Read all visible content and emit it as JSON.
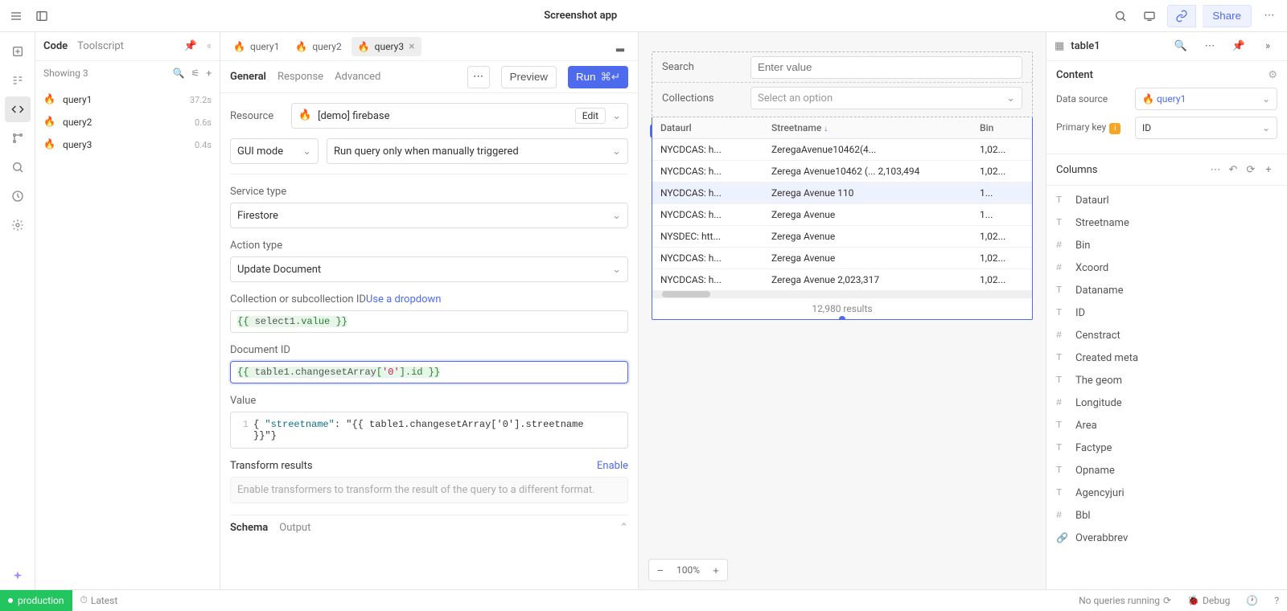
{
  "app_title": "Screenshot app",
  "topbar": {
    "share_label": "Share"
  },
  "code_panel": {
    "tabs": {
      "code": "Code",
      "toolscript": "Toolscript"
    },
    "showing": "Showing 3",
    "queries": [
      {
        "name": "query1",
        "time": "37.2s"
      },
      {
        "name": "query2",
        "time": "0.6s"
      },
      {
        "name": "query3",
        "time": "0.4s"
      }
    ]
  },
  "editor": {
    "tabs": [
      {
        "name": "query1",
        "active": false
      },
      {
        "name": "query2",
        "active": false
      },
      {
        "name": "query3",
        "active": true
      }
    ],
    "subtabs": {
      "general": "General",
      "response": "Response",
      "advanced": "Advanced"
    },
    "preview": "Preview",
    "run": "Run",
    "run_shortcut": "⌘↵",
    "resource_label": "Resource",
    "resource_name": "[demo] firebase",
    "edit": "Edit",
    "gui_mode": "GUI mode",
    "run_mode": "Run query only when manually triggered",
    "service_type_label": "Service type",
    "service_type": "Firestore",
    "action_type_label": "Action type",
    "action_type": "Update Document",
    "collection_label": "Collection or subcollection ID",
    "use_dropdown": "Use a dropdown",
    "collection_code_prefix": "{{ ",
    "collection_code_1": "select1",
    "collection_code_dot": ".",
    "collection_code_2": "value",
    "collection_code_suffix": " }}",
    "document_id_label": "Document ID",
    "doc_code_prefix": "{{ ",
    "doc_code_1": "table1",
    "doc_code_2": "changesetArray",
    "doc_code_idx": "'0'",
    "doc_code_3": "id",
    "doc_code_suffix": " }}",
    "value_label": "Value",
    "value_line_no": "1",
    "value_code_open": "{ ",
    "value_code_key": "\"streetname\"",
    "value_code_colon": ": ",
    "value_code_q1": "\"",
    "value_code_tmpl_open": "{{ ",
    "value_code_t1": "table1",
    "value_code_t2": "changesetArray",
    "value_code_idx": "'0'",
    "value_code_t3": "streetname",
    "value_code_tmpl_close": " }}",
    "value_code_q2": "\"",
    "value_code_close": "}",
    "transform_label": "Transform results",
    "enable": "Enable",
    "transform_placeholder": "Enable transformers to transform the result of the query to a different format.",
    "schema": "Schema",
    "output": "Output"
  },
  "canvas": {
    "table_chip": "table1",
    "search_label": "Search",
    "search_placeholder": "Enter value",
    "collections_label": "Collections",
    "collections_placeholder": "Select an option",
    "table": {
      "headers": {
        "dataurl": "Dataurl",
        "streetname": "Streetname",
        "bin": "Bin"
      },
      "rows": [
        {
          "dataurl": "NYCDCAS: h...",
          "streetname": "ZeregaAvenue10462(4...",
          "bin": "1,02..."
        },
        {
          "dataurl": "NYCDCAS: h...",
          "streetname": "Zerega Avenue10462 (... 2,103,494",
          "bin": "1,02..."
        },
        {
          "dataurl": "NYCDCAS: h...",
          "streetname": "Zerega Avenue 110",
          "bin": "1..."
        },
        {
          "dataurl": "NYCDCAS: h...",
          "streetname": "Zerega Avenue",
          "bin": "1..."
        },
        {
          "dataurl": "NYSDEC: htt...",
          "streetname": "Zerega Avenue",
          "bin": "1,02..."
        },
        {
          "dataurl": "NYCDCAS: h...",
          "streetname": "Zerega Avenue",
          "bin": "1,02..."
        },
        {
          "dataurl": "NYCDCAS: h...",
          "streetname": "Zerega Avenue          2,023,317",
          "bin": "1,02..."
        }
      ],
      "results": "12,980 results"
    },
    "zoom": "100%"
  },
  "inspector": {
    "title": "table1",
    "content": "Content",
    "data_source_label": "Data source",
    "data_source": "query1",
    "primary_key_label": "Primary key",
    "primary_key": "ID",
    "columns_label": "Columns",
    "columns": [
      {
        "icon": "T",
        "name": "Dataurl"
      },
      {
        "icon": "T",
        "name": "Streetname"
      },
      {
        "icon": "#",
        "name": "Bin"
      },
      {
        "icon": "#",
        "name": "Xcoord"
      },
      {
        "icon": "T",
        "name": "Dataname"
      },
      {
        "icon": "T",
        "name": "ID"
      },
      {
        "icon": "#",
        "name": "Censtract"
      },
      {
        "icon": "T",
        "name": "Created meta"
      },
      {
        "icon": "T",
        "name": "The geom"
      },
      {
        "icon": "#",
        "name": "Longitude"
      },
      {
        "icon": "T",
        "name": "Area"
      },
      {
        "icon": "T",
        "name": "Factype"
      },
      {
        "icon": "T",
        "name": "Opname"
      },
      {
        "icon": "T",
        "name": "Agencyjuri"
      },
      {
        "icon": "#",
        "name": "Bbl"
      },
      {
        "icon": "link",
        "name": "Overabbrev"
      }
    ]
  },
  "status": {
    "env": "production",
    "latest": "Latest",
    "queries": "No queries running",
    "debug": "Debug"
  }
}
